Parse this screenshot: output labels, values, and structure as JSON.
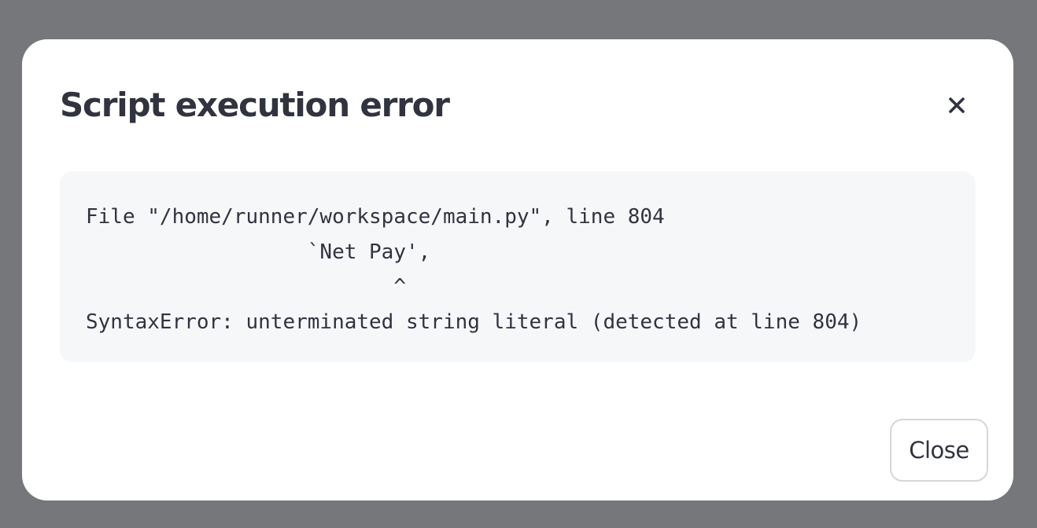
{
  "dialog": {
    "title": "Script execution error",
    "close_icon": "close-icon",
    "error_lines": [
      "File \"/home/runner/workspace/main.py\", line 804",
      "                  `Net Pay',",
      "                         ^",
      "SyntaxError: unterminated string literal (detected at line 804)"
    ],
    "close_button_label": "Close"
  },
  "colors": {
    "overlay": "#76777b",
    "dialog_background": "#ffffff",
    "text": "#31333f",
    "code_background": "#f6f7f9",
    "button_border": "#d6d6d9"
  }
}
